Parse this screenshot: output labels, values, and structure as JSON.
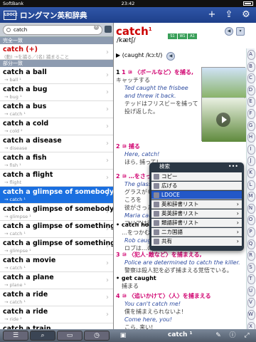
{
  "status": {
    "carrier": "SoftBank",
    "time": "23:42"
  },
  "app": {
    "logo": "LDOCE",
    "title": "ロングマン英和辞典"
  },
  "search": {
    "value": "catch"
  },
  "sections": {
    "exact": "完全一致",
    "partial": "部分一致"
  },
  "results": [
    {
      "h": "catch (+)",
      "s": "(動) →を捕る／(名) 捕まること"
    },
    {
      "h": "catch a ball",
      "s": "→ ball ¹"
    },
    {
      "h": "catch a bug",
      "s": "→ bug ¹"
    },
    {
      "h": "catch a bus",
      "s": "→ catch ¹"
    },
    {
      "h": "catch a cold",
      "s": "→ cold ²"
    },
    {
      "h": "catch a disease",
      "s": "→ disease"
    },
    {
      "h": "catch a fish",
      "s": "→ fish ¹"
    },
    {
      "h": "catch a flight",
      "s": "→ flight"
    },
    {
      "h": "catch a glimpse of somebody",
      "s": "→ catch ¹"
    },
    {
      "h": "catch a glimpse of somebody",
      "s": "→ glimpse ¹"
    },
    {
      "h": "catch a glimpse of something",
      "s": "→ catch ¹"
    },
    {
      "h": "catch a glimpse of something",
      "s": "→ glimpse ¹"
    },
    {
      "h": "catch a movie",
      "s": "→ catch ¹"
    },
    {
      "h": "catch a plane",
      "s": "→ plane ¹"
    },
    {
      "h": "catch a ride",
      "s": "→ catch ¹"
    },
    {
      "h": "catch a ride",
      "s": "→ ride ²"
    },
    {
      "h": "catch a train",
      "s": ""
    }
  ],
  "entry": {
    "headword": "catch",
    "sup": "1",
    "levels": [
      "S1",
      "W1",
      "A1"
    ],
    "pron": "/kætʃ/",
    "pos": "(caught /kɔːt/)",
    "s1": "1 ⑩ 〈ボールなど〉を捕る,",
    "s1b": "キャッチする",
    "e1": "Ted caught the frisbee and threw it back.",
    "j1": "テッドはフリスビーを捕って投げ返した。",
    "s2": "2 ⑩ 捕る",
    "e2": "Here, catch!",
    "j2": "ほら, 捕って!",
    "s3": "2 ⑩ …をさっとつかむ",
    "e3": "The glass nearly fell",
    "j3": "グラスがもう少しで落ちるところを",
    "j3b": "彼がさっとつかんだ",
    "e3b": "Maria caught him",
    "j3c": "マリアは彼の腕をつかんだ",
    "idiom1": "catch hold of somethi…",
    "idiom1j": "…をつかむ",
    "e4": "Rob caught hold of",
    "j4": "ロブは…の片端をつかんだ",
    "s4": "3 ⑩ 〈犯人･敵など〉を捕まえる,",
    "e5": "Police are determined to catch the killer.",
    "j5": "警察は殺人犯を必ず捕まえる覚悟でいる。",
    "idiom2": "get caught",
    "idiom2j": "捕まる",
    "s5": "4 ⑩ 〈追いかけて〉〈人〉を捕まえる",
    "e6": "You can't catch me!",
    "j6": "僕を捕まえられないよ!",
    "e7": "Come here, you!",
    "j7": "こら, 来い!"
  },
  "menu": {
    "search": "検索",
    "dots": "•••",
    "items": [
      "コピー",
      "広げる",
      "LDOCE",
      "英和辞書リスト",
      "英英辞書リスト",
      "類語辞書リスト",
      "二カ国語",
      "共有"
    ]
  },
  "alpha": [
    "A",
    "B",
    "C",
    "D",
    "E",
    "F",
    "G",
    "H",
    "I",
    "J",
    "K",
    "L",
    "M",
    "N",
    "O",
    "P",
    "Q",
    "R",
    "S",
    "T",
    "U",
    "V",
    "W",
    "X",
    "Y",
    "Z"
  ],
  "bottom": {
    "title": "catch ¹"
  }
}
